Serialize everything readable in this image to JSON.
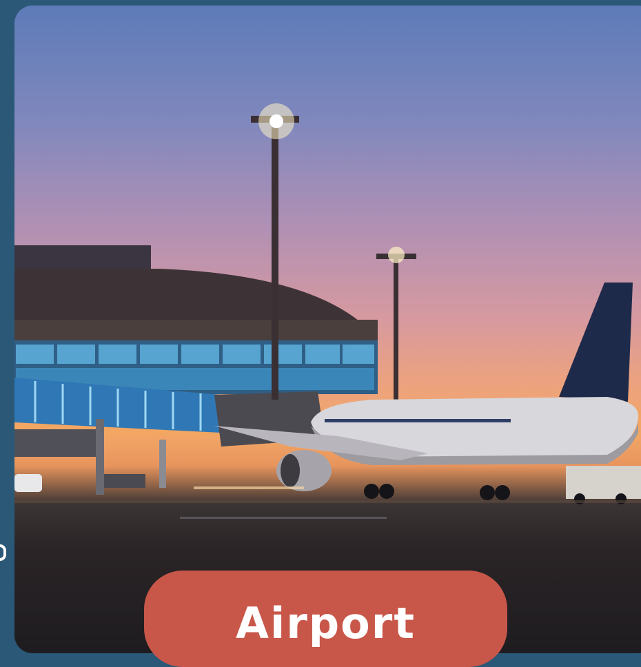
{
  "photo": {
    "icon": "airport-photo",
    "colors": {
      "sky_top": "#5d7bb8",
      "sky_sunset": "#f3a767",
      "tarmac": "#1e1c20",
      "terminal_glass": "#3d8bbf",
      "aircraft_body": "#d7d7dc",
      "aircraft_tail": "#1e2a4a"
    }
  },
  "cta": {
    "label": "Airport",
    "background": "#c8574a",
    "text_color": "#ffffff"
  },
  "side_glyph": {
    "icon": "partial-letter-icon"
  }
}
